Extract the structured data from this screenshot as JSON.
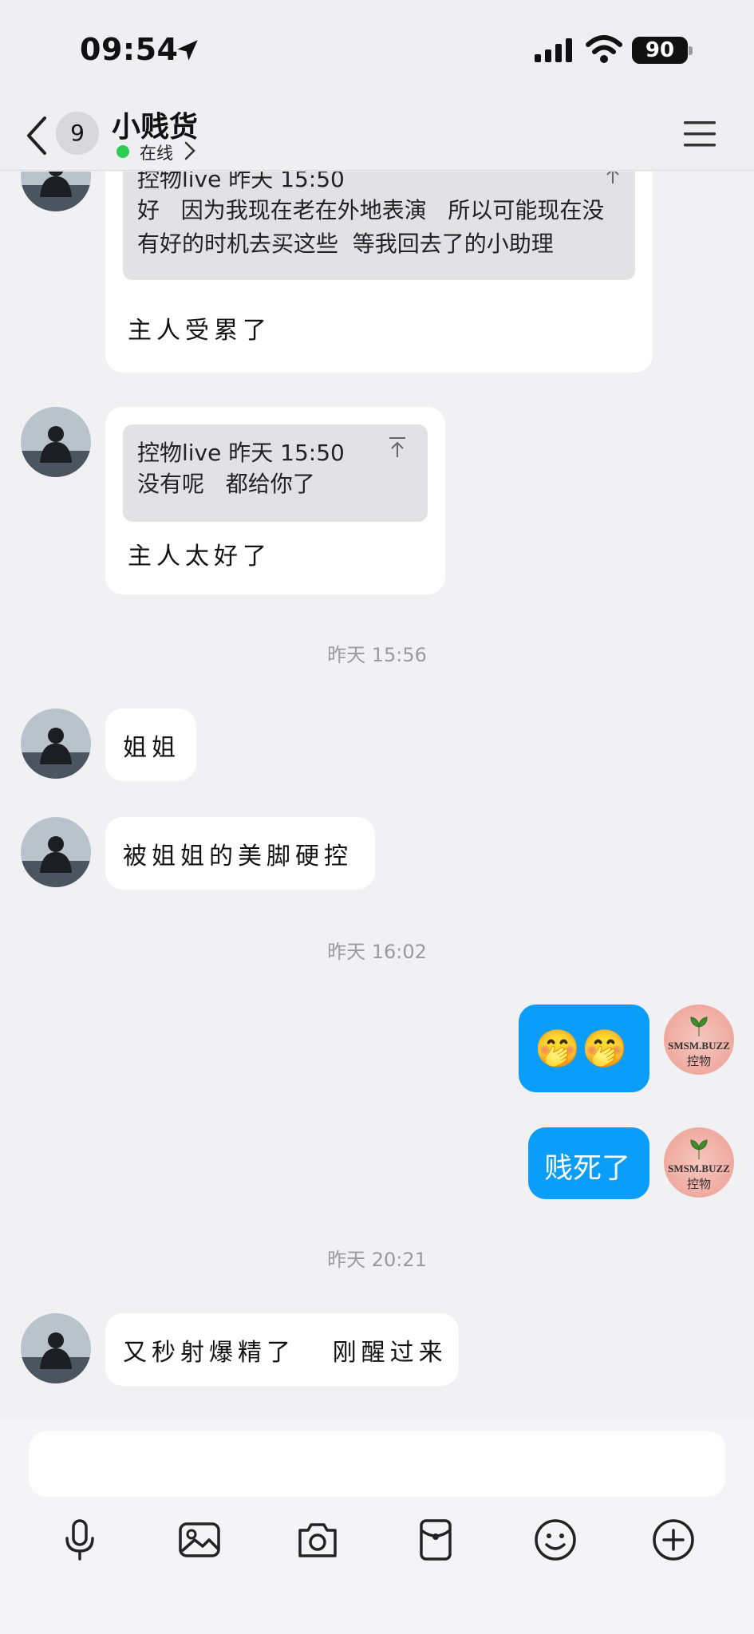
{
  "status_bar": {
    "time": "09:54",
    "battery": "90"
  },
  "nav": {
    "badge": "9",
    "title": "小贱货",
    "status": "在线"
  },
  "messages": {
    "m1": {
      "quote_meta": "控物live 昨天 15:50",
      "quote_text": "好   因为我现在老在外地表演   所以可能现在没\n有好的时机去买这些  等我回去了的小助理",
      "reply": "主人受累了"
    },
    "m2": {
      "quote_meta": "控物live 昨天 15:50",
      "quote_text": "没有呢   都给你了",
      "reply": "主人太好了"
    },
    "ts1": "昨天 15:56",
    "m3": "姐姐",
    "m4": "被姐姐的美脚硬控",
    "ts2": "昨天 16:02",
    "m5": "🤭🤭",
    "m6": "贱死了",
    "ts3": "昨天 20:21",
    "m7": "又秒射爆精了   刚醒过来"
  },
  "my_avatar": {
    "brand": "SMSM.BUZZ",
    "brand_cn": "控物"
  },
  "colors": {
    "accent": "#0a9dfa",
    "online": "#2ecc54"
  },
  "icons": [
    "microphone-icon",
    "image-icon",
    "camera-icon",
    "red-packet-icon",
    "emoji-icon",
    "plus-icon"
  ]
}
